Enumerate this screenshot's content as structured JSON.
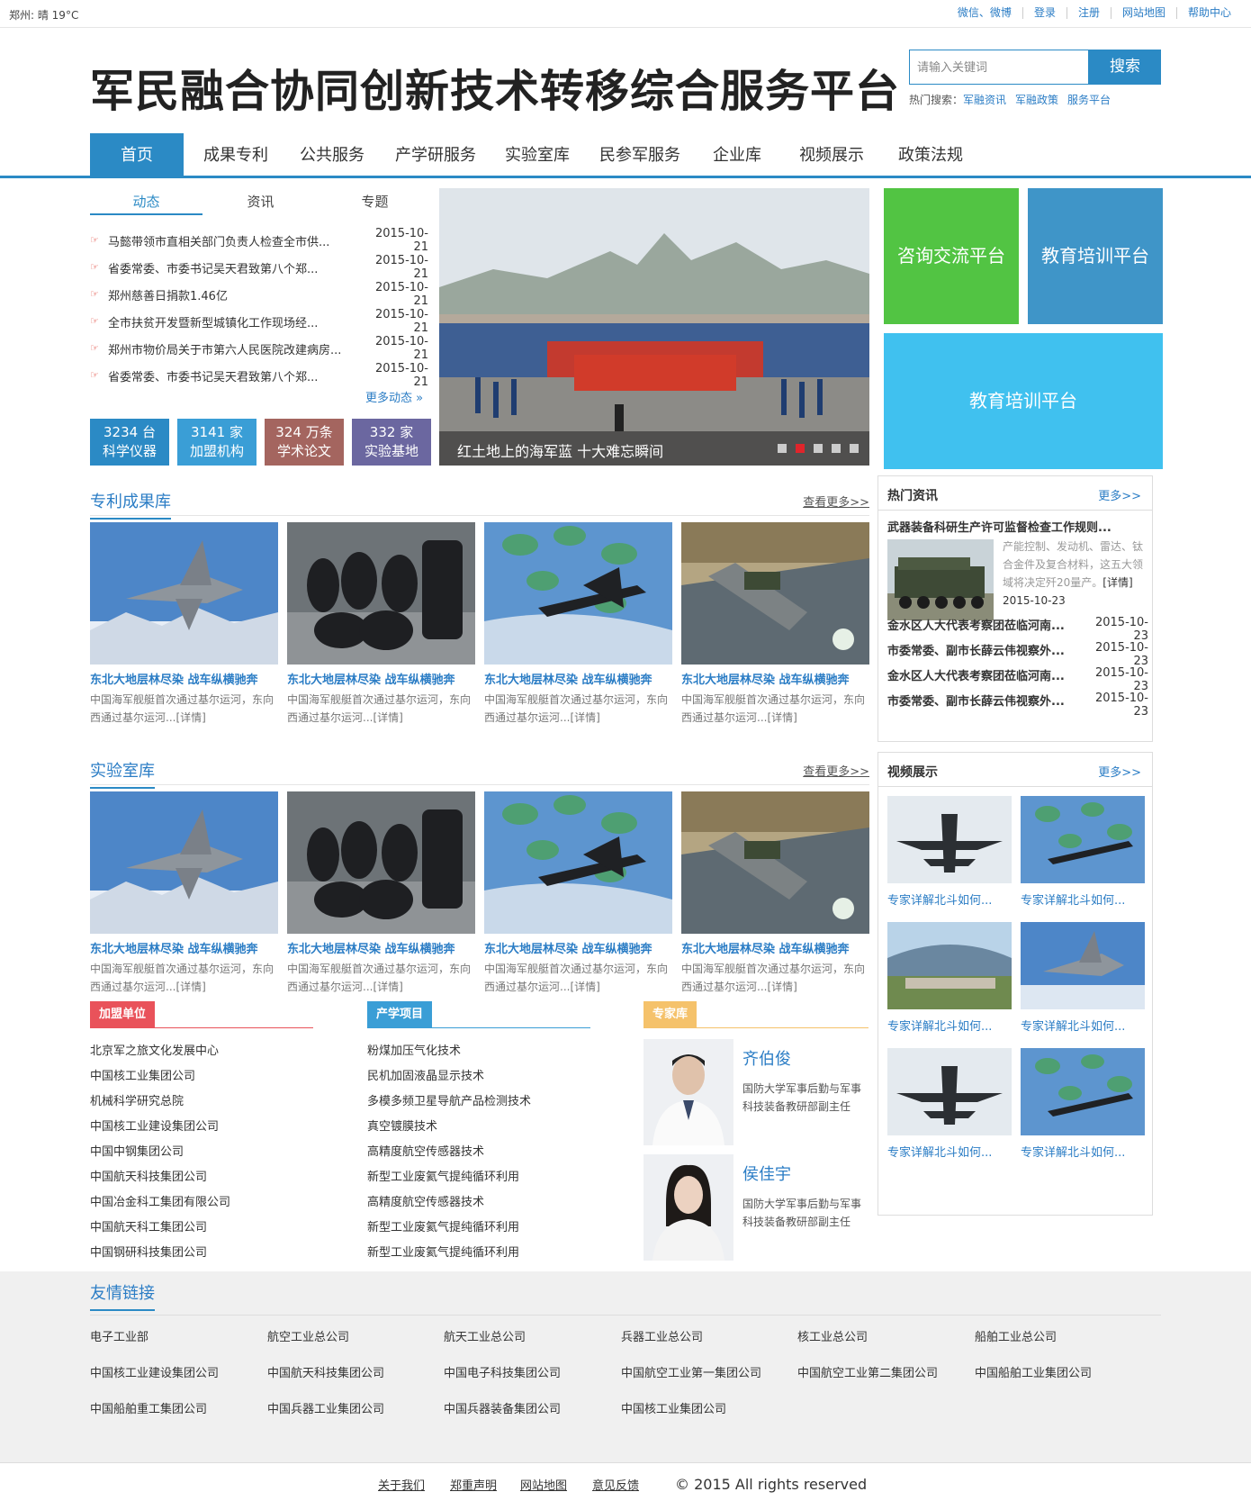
{
  "topbar": {
    "weather": "郑州:  晴  19°C",
    "links": [
      "微信、微博",
      "登录",
      "注册",
      "网站地图",
      "帮助中心"
    ]
  },
  "header": {
    "title": "军民融合协同创新技术转移综合服务平台",
    "search_placeholder": "请输入关键词",
    "search_button": "搜索",
    "hot_label": "热门搜索：",
    "hot_links": [
      "军融资讯",
      "军融政策",
      "服务平台"
    ]
  },
  "nav": {
    "items": [
      "首页",
      "成果专利",
      "公共服务",
      "产学研服务",
      "实验室库",
      "民参军服务",
      "企业库",
      "视频展示",
      "政策法规"
    ]
  },
  "news": {
    "tabs": [
      "动态",
      "资讯",
      "专题"
    ],
    "items": [
      {
        "title": "马懿带领市直相关部门负责人检查全市供...",
        "date": "2015-10-21"
      },
      {
        "title": "省委常委、市委书记吴天君致第八个郑...",
        "date": "2015-10-21"
      },
      {
        "title": "郑州慈善日捐款1.46亿",
        "date": "2015-10-21"
      },
      {
        "title": "全市扶贫开发暨新型城镇化工作现场经...",
        "date": "2015-10-21"
      },
      {
        "title": "郑州市物价局关于市第六人民医院改建病房...",
        "date": "2015-10-21"
      },
      {
        "title": "省委常委、市委书记吴天君致第八个郑...",
        "date": "2015-10-21"
      }
    ],
    "more": "更多动态 »"
  },
  "stats": [
    {
      "value": "3234 台",
      "label": "科学仪器",
      "color": "#2b8ac5"
    },
    {
      "value": "3141 家",
      "label": "加盟机构",
      "color": "#3a9ed6"
    },
    {
      "value": "324 万条",
      "label": "学术论文",
      "color": "#a4655f"
    },
    {
      "value": "332 家",
      "label": "实验基地",
      "color": "#6b67a0"
    }
  ],
  "carousel": {
    "caption": "红土地上的海军蓝 十大难忘瞬间"
  },
  "tiles": [
    {
      "label": "咨询交流平台",
      "color": "#52c443"
    },
    {
      "label": "教育培训平台",
      "color": "#3f95c8"
    },
    {
      "label": "教育培训平台",
      "color": "#40c1ef"
    }
  ],
  "patents": {
    "title": "专利成果库",
    "more": "查看更多>>",
    "cards": [
      {
        "title": "东北大地层林尽染 战车纵横驰奔",
        "desc": "中国海军舰艇首次通过基尔运河，东向西通过基尔运河...[详情]"
      },
      {
        "title": "东北大地层林尽染 战车纵横驰奔",
        "desc": "中国海军舰艇首次通过基尔运河，东向西通过基尔运河...[详情]"
      },
      {
        "title": "东北大地层林尽染 战车纵横驰奔",
        "desc": "中国海军舰艇首次通过基尔运河，东向西通过基尔运河...[详情]"
      },
      {
        "title": "东北大地层林尽染 战车纵横驰奔",
        "desc": "中国海军舰艇首次通过基尔运河，东向西通过基尔运河...[详情]"
      }
    ]
  },
  "labs": {
    "title": "实验室库",
    "more": "查看更多>>",
    "cards": [
      {
        "title": "东北大地层林尽染 战车纵横驰奔",
        "desc": "中国海军舰艇首次通过基尔运河，东向西通过基尔运河...[详情]"
      },
      {
        "title": "东北大地层林尽染 战车纵横驰奔",
        "desc": "中国海军舰艇首次通过基尔运河，东向西通过基尔运河...[详情]"
      },
      {
        "title": "东北大地层林尽染 战车纵横驰奔",
        "desc": "中国海军舰艇首次通过基尔运河，东向西通过基尔运河...[详情]"
      },
      {
        "title": "东北大地层林尽染 战车纵横驰奔",
        "desc": "中国海军舰艇首次通过基尔运河，东向西通过基尔运河...[详情]"
      }
    ]
  },
  "hot": {
    "title": "热门资讯",
    "more": "更多>>",
    "first_title": "武器装备科研生产许可监督检查工作规则...",
    "first_desc": "产能控制、发动机、雷达、钛合金件及复合材料，这五大领域将决定歼20量产。",
    "first_detail": "[详情]",
    "first_date": "2015-10-23",
    "items": [
      {
        "title": "金水区人大代表考察团莅临河南...",
        "date": "2015-10-23"
      },
      {
        "title": "市委常委、副市长薛云伟视察外...",
        "date": "2015-10-23"
      },
      {
        "title": "金水区人大代表考察团莅临河南...",
        "date": "2015-10-23"
      },
      {
        "title": "市委常委、副市长薛云伟视察外...",
        "date": "2015-10-23"
      }
    ]
  },
  "videos": {
    "title": "视频展示",
    "more": "更多>>",
    "items": [
      "专家详解北斗如何...",
      "专家详解北斗如何...",
      "专家详解北斗如何...",
      "专家详解北斗如何...",
      "专家详解北斗如何...",
      "专家详解北斗如何..."
    ]
  },
  "members": {
    "title": "加盟单位",
    "color": "#e9525a",
    "items": [
      "北京军之旅文化发展中心",
      "中国核工业集团公司",
      "机械科学研究总院",
      "中国核工业建设集团公司",
      "中国中钢集团公司",
      "中国航天科技集团公司",
      "中国冶金科工集团有限公司",
      "中国航天科工集团公司",
      "中国钢研科技集团公司"
    ]
  },
  "projects": {
    "title": "产学项目",
    "color": "#3a9ed6",
    "items": [
      "粉煤加压气化技术",
      "民机加固液晶显示技术",
      "多模多频卫星导航产品检测技术",
      "真空镀膜技术",
      "高精度航空传感器技术",
      "新型工业废氦气提纯循环利用",
      "高精度航空传感器技术",
      "新型工业废氦气提纯循环利用",
      "新型工业废氦气提纯循环利用"
    ]
  },
  "experts": {
    "title": "专家库",
    "color": "#f5c26b",
    "items": [
      {
        "name": "齐伯俊",
        "desc": "国防大学军事后勤与军事科技装备教研部副主任"
      },
      {
        "name": "侯佳宇",
        "desc": "国防大学军事后勤与军事科技装备教研部副主任"
      }
    ]
  },
  "friends": {
    "title": "友情链接",
    "links": [
      "电子工业部",
      "航空工业总公司",
      "航天工业总公司",
      "兵器工业总公司",
      "核工业总公司",
      "船舶工业总公司",
      "中国核工业建设集团公司",
      "中国航天科技集团公司",
      "中国电子科技集团公司",
      "中国航空工业第一集团公司",
      "中国航空工业第二集团公司",
      "中国船舶工业集团公司",
      "中国船舶重工集团公司",
      "中国兵器工业集团公司",
      "中国兵器装备集团公司",
      "中国核工业集团公司"
    ]
  },
  "footer": {
    "links": [
      "关于我们",
      "郑重声明",
      "网站地图",
      "意见反馈"
    ],
    "copyright": "© 2015 All rights reserved"
  }
}
